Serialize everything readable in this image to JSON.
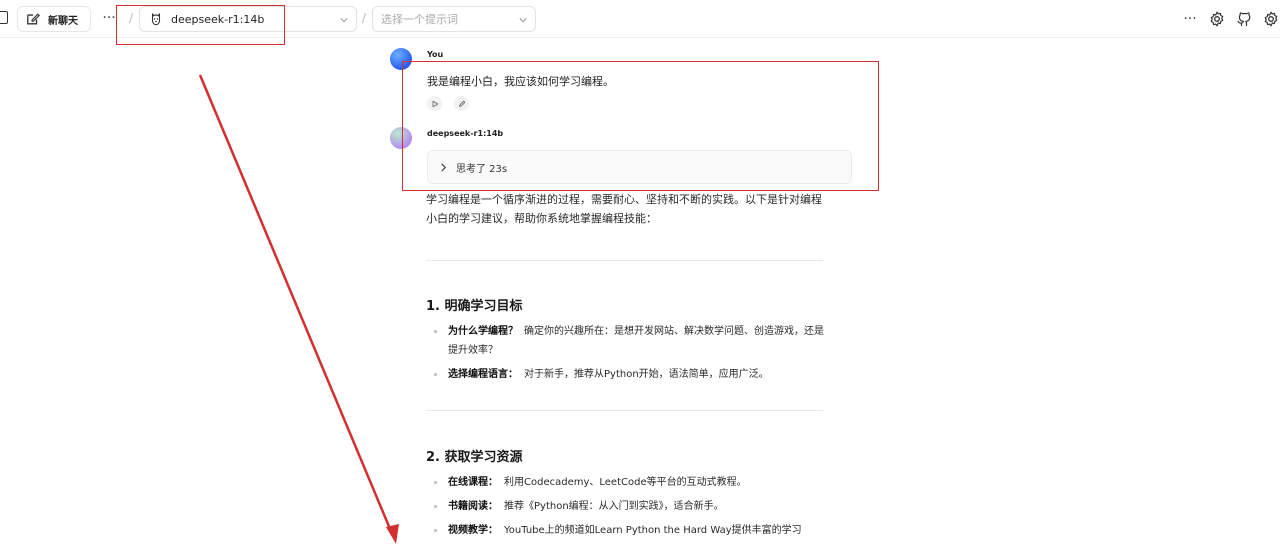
{
  "toolbar": {
    "new_chat_label": "新聊天",
    "more_label": "···",
    "separator": "/",
    "model_label": "deepseek-r1:14b",
    "prompt_placeholder": "选择一个提示词",
    "right_more_label": "···"
  },
  "chat": {
    "user_name": "You",
    "user_message": "我是编程小白，我应该如何学习编程。",
    "bot_name": "deepseek-r1:14b",
    "thinking_label": "思考了 23s",
    "intro": "学习编程是一个循序渐进的过程，需要耐心、坚持和不断的实践。以下是针对编程小白的学习建议，帮助你系统地掌握编程技能：",
    "sections": [
      {
        "title": "1. 明确学习目标",
        "items": [
          {
            "label": "为什么学编程？",
            "text": "确定你的兴趣所在：是想开发网站、解决数学问题、创造游戏，还是提升效率？"
          },
          {
            "label": "选择编程语言：",
            "text": "对于新手，推荐从Python开始，语法简单，应用广泛。"
          }
        ]
      },
      {
        "title": "2. 获取学习资源",
        "items": [
          {
            "label": "在线课程：",
            "text": "利用Codecademy、LeetCode等平台的互动式教程。"
          },
          {
            "label": "书籍阅读：",
            "text": "推荐《Python编程：从入门到实践》，适合新手。"
          },
          {
            "label": "视频教学：",
            "text": "YouTube上的频道如Learn Python the Hard Way提供丰富的学习"
          }
        ]
      }
    ]
  },
  "colors": {
    "annotation": "#d32f2f",
    "user_avatar": "#2a5cf0",
    "bot_avatar": "#b48cf0"
  },
  "icons": [
    "sidebar-toggle-icon",
    "edit-icon",
    "llama-icon",
    "chevron-down-icon",
    "play-icon",
    "pencil-icon",
    "chevron-right-icon",
    "settings-icon",
    "github-icon"
  ]
}
